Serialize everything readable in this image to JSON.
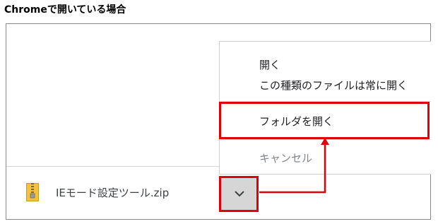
{
  "heading": "Chromeで開いている場合",
  "download_bar": {
    "file_name": "IEモード設定ツール.zip",
    "file_icon": "zip-folder-icon",
    "menu_button_icon": "chevron-down-icon"
  },
  "context_menu": {
    "items": [
      {
        "label": "開く",
        "enabled": true
      },
      {
        "label": "この種類のファイルは常に開く",
        "enabled": true
      },
      {
        "label": "フォルダを開く",
        "enabled": true,
        "highlighted": true
      },
      {
        "label": "キャンセル",
        "enabled": false
      }
    ]
  },
  "annotation": {
    "color": "#e0000a",
    "arrow_icon": "arrow-up-icon"
  }
}
